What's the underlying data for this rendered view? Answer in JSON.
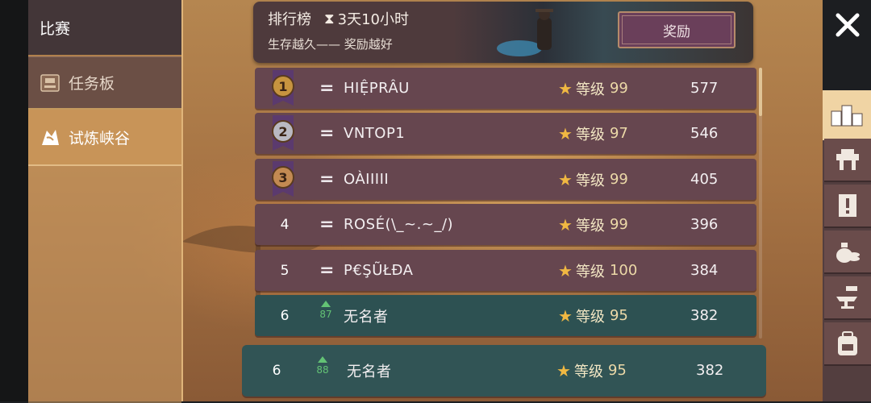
{
  "sidebar": {
    "header": "比赛",
    "items": [
      {
        "label": "任务板",
        "icon": "task-board-icon"
      },
      {
        "label": "试炼峡谷",
        "icon": "trial-canyon-icon",
        "active": true
      }
    ]
  },
  "banner": {
    "title": "排行榜",
    "timer": "3天10小时",
    "subtitle": "生存越久—— 奖励越好",
    "reward_button": "奖励"
  },
  "level_prefix": "等级",
  "rows": [
    {
      "rank": "1",
      "trend": "=",
      "name": "HIỆPRÂU",
      "level": "99",
      "score": "577"
    },
    {
      "rank": "2",
      "trend": "=",
      "name": "VNTOP1",
      "level": "97",
      "score": "546"
    },
    {
      "rank": "3",
      "trend": "=",
      "name": "OÀIIIII",
      "level": "99",
      "score": "405"
    },
    {
      "rank": "4",
      "trend": "=",
      "name": "ROSÉ(\\_~.~_/)",
      "level": "99",
      "score": "396"
    },
    {
      "rank": "5",
      "trend": "=",
      "name": "P€ŞŨŁĐA",
      "level": "100",
      "score": "384"
    },
    {
      "rank": "6",
      "trend": "87",
      "name": "无名者",
      "level": "95",
      "score": "382"
    }
  ],
  "pinned_row": {
    "rank": "6",
    "trend": "88",
    "name": "无名者",
    "level": "95",
    "score": "382"
  },
  "toolbar": {
    "items": [
      "leaderboard-podium-icon",
      "forge-anvil-table-icon",
      "quest-scroll-icon",
      "coin-bag-icon",
      "anvil-hammer-icon",
      "backpack-icon"
    ]
  },
  "colors": {
    "row": "#66464f",
    "row_self": "#2d5152",
    "accent_gold": "#e0b57a",
    "trend_up": "#63c275",
    "star": "#f0b842"
  }
}
